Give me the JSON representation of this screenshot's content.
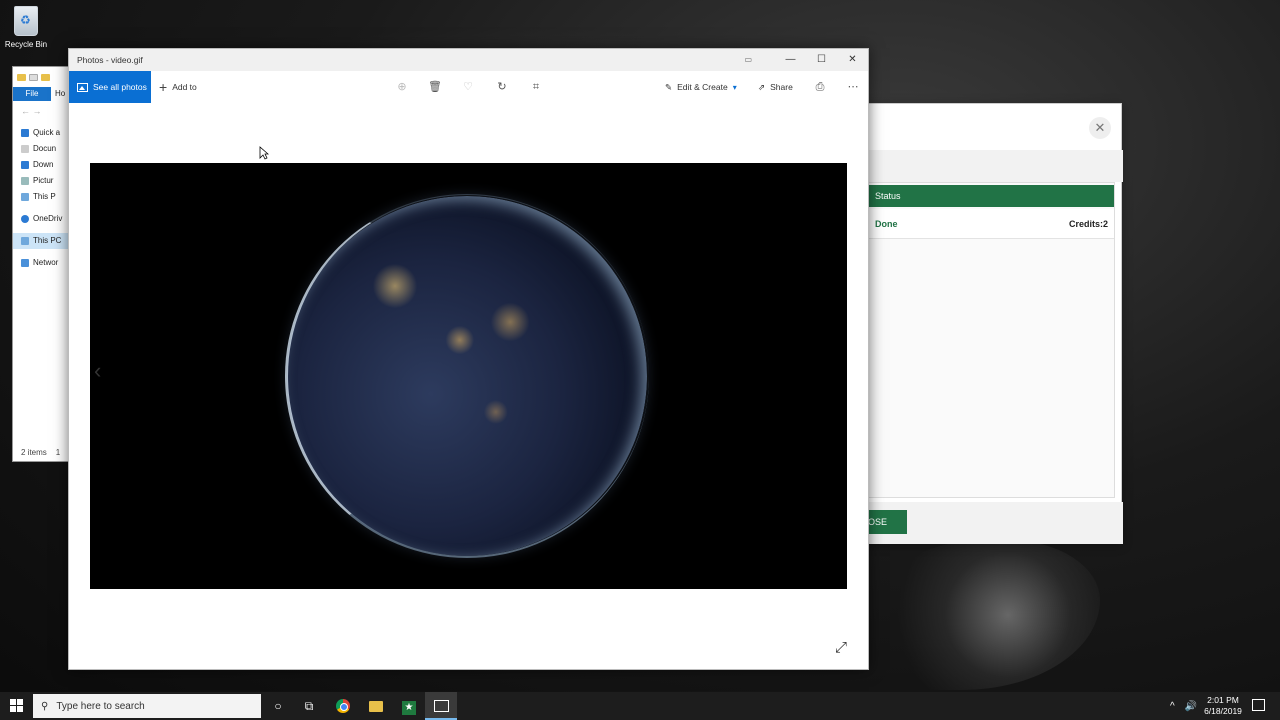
{
  "desktop": {
    "recycle_bin_label": "Recycle Bin"
  },
  "explorer": {
    "file_tab": "File",
    "home_tab": "Ho",
    "nav_items": [
      {
        "label": "Quick a",
        "icon": "star-icon"
      },
      {
        "label": "Docun",
        "icon": "document-icon"
      },
      {
        "label": "Down",
        "icon": "download-icon"
      },
      {
        "label": "Pictur",
        "icon": "pictures-icon"
      },
      {
        "label": "This P",
        "icon": "computer-icon"
      },
      {
        "label": "OneDriv",
        "icon": "cloud-icon"
      },
      {
        "label": "This PC",
        "icon": "computer-icon"
      },
      {
        "label": "Networ",
        "icon": "network-icon"
      }
    ],
    "status_text": "2 items",
    "status_extra": "1"
  },
  "dialog": {
    "close_glyph": "✕",
    "table_header": "Status",
    "row_status": "Done",
    "row_credits": "Credits:2",
    "button_label": "OSE",
    "accent_color": "#217346"
  },
  "photos": {
    "window_title": "Photos - video.gif",
    "see_all_label": "See all photos",
    "add_to_label": "Add to",
    "edit_create_label": "Edit & Create",
    "share_label": "Share",
    "accent_color": "#0a6fd3"
  },
  "taskbar": {
    "search_placeholder": "Type here to search",
    "time": "2:01 PM",
    "date": "6/18/2019"
  }
}
